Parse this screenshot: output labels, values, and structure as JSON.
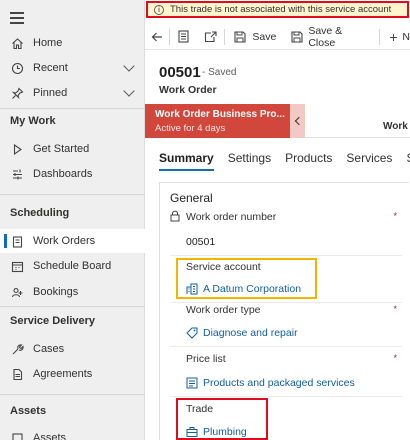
{
  "sidebar": {
    "items": [
      {
        "label": "Home",
        "icon": "home-icon"
      },
      {
        "label": "Recent",
        "icon": "clock-icon"
      },
      {
        "label": "Pinned",
        "icon": "pin-icon"
      }
    ],
    "sections": [
      {
        "title": "My Work",
        "items": [
          {
            "label": "Get Started",
            "icon": "play-icon"
          },
          {
            "label": "Dashboards",
            "icon": "dashboard-icon"
          }
        ]
      },
      {
        "title": "Scheduling",
        "items": [
          {
            "label": "Work Orders",
            "icon": "clipboard-icon"
          },
          {
            "label": "Schedule Board",
            "icon": "calendar-icon"
          },
          {
            "label": "Bookings",
            "icon": "bookings-icon"
          }
        ]
      },
      {
        "title": "Service Delivery",
        "items": [
          {
            "label": "Cases",
            "icon": "wrench-icon"
          },
          {
            "label": "Agreements",
            "icon": "document-icon"
          }
        ]
      },
      {
        "title": "Assets",
        "items": [
          {
            "label": "Assets",
            "icon": "asset-icon"
          }
        ]
      }
    ]
  },
  "warning": {
    "text": "This trade is not associated with this service account"
  },
  "toolbar": {
    "save": "Save",
    "save_close": "Save & Close",
    "new": "N"
  },
  "record": {
    "id": "00501",
    "status": "- Saved",
    "entity": "Work Order"
  },
  "bpf": {
    "stage_name": "Work Order Business Pro...",
    "stage_duration": "Active for 4 days",
    "next_stage": "Work"
  },
  "tabs": [
    "Summary",
    "Settings",
    "Products",
    "Services",
    "Se"
  ],
  "form": {
    "section_title": "General",
    "fields": {
      "work_order_number": {
        "label": "Work order number",
        "value": "00501",
        "required": "*"
      },
      "service_account": {
        "label": "Service account",
        "value": "A Datum Corporation"
      },
      "work_order_type": {
        "label": "Work order type",
        "value": "Diagnose and repair",
        "required": "*"
      },
      "price_list": {
        "label": "Price list",
        "value": "Products and packaged services",
        "required": "*"
      },
      "trade": {
        "label": "Trade",
        "value": "Plumbing"
      }
    }
  },
  "colors": {
    "accent": "#0f6cbd",
    "warning_bg": "#fff4ce",
    "stage_bg": "#d2473c",
    "highlight_red": "#e00b1c",
    "highlight_yellow": "#f2b600"
  }
}
